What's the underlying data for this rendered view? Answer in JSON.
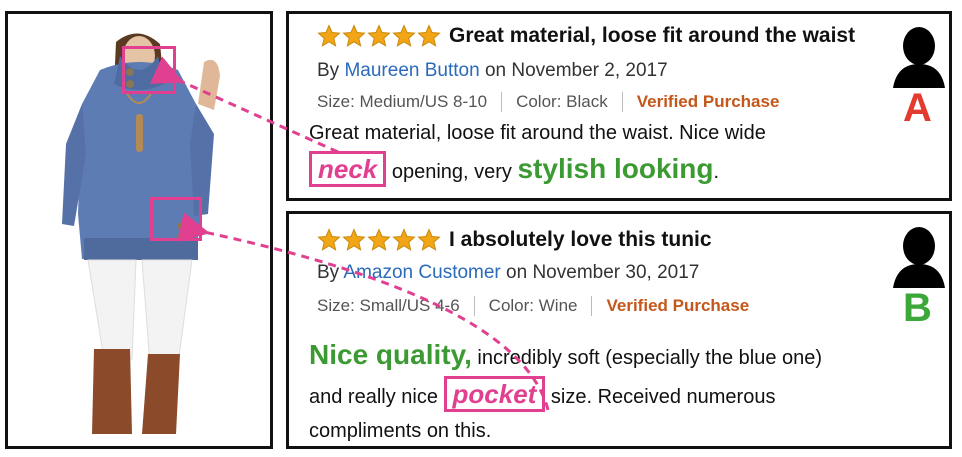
{
  "reviews": [
    {
      "stars": 5,
      "title": "Great material, loose fit around the waist",
      "by_prefix": "By",
      "author": "Maureen Button",
      "date": "on November 2, 2017",
      "size": "Size: Medium/US 8-10",
      "color": "Color: Black",
      "verified": "Verified Purchase",
      "body_line1": "Great material, loose fit around the waist. Nice wide",
      "highlight_aspect": "neck",
      "body_line2_mid": " opening, very ",
      "highlight_opinion": "stylish looking",
      "body_line2_end": ".",
      "reviewer": "A"
    },
    {
      "stars": 5,
      "title": "I absolutely love this tunic",
      "by_prefix": "By",
      "author": "Amazon Customer",
      "date": "on November 30, 2017",
      "size": "Size: Small/US 4-6",
      "color": "Color: Wine",
      "verified": "Verified Purchase",
      "highlight_opinion": "Nice quality,",
      "body_line1_rest": " incredibly soft (especially the blue one)",
      "body_line2_start": "and really nice ",
      "highlight_aspect": "pocket",
      "body_line2_end": " size. Received numerous",
      "body_line3": "compliments on this.",
      "reviewer": "B"
    }
  ],
  "colors": {
    "star": "#f2a516",
    "author_link": "#2a6ab8",
    "verified": "#c4571a",
    "opinion_highlight": "#3c9a32",
    "aspect_highlight": "#e0408f",
    "reviewer_a": "#e33b2e",
    "reviewer_b": "#3ca83a"
  },
  "icons": [
    "star-icon",
    "person-silhouette-icon",
    "dashed-arrow"
  ]
}
